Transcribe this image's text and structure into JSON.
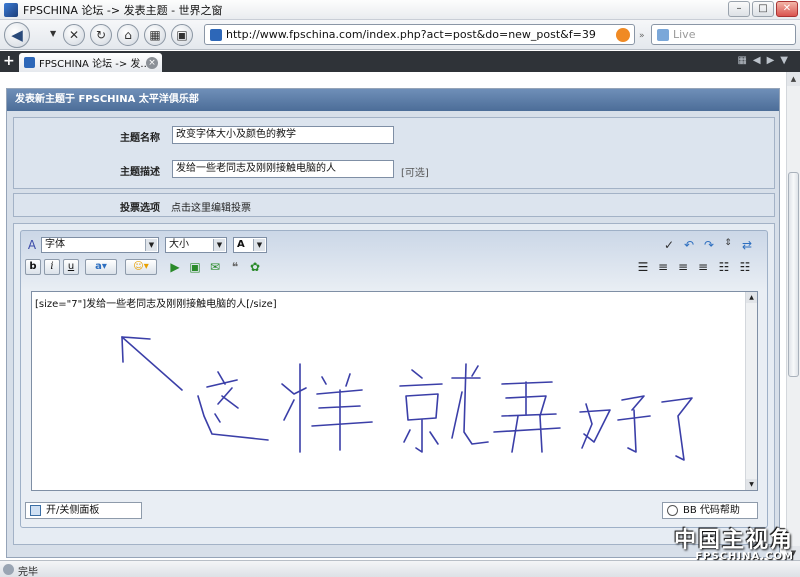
{
  "window": {
    "title": "FPSCHINA 论坛 -> 发表主题 - 世界之窗"
  },
  "nav": {
    "url": "http://www.fpschina.com/index.php?act=post&do=new_post&f=39",
    "search_placeholder": "Live"
  },
  "tabs": [
    {
      "label": "FPSCHINA 论坛 -> 发..."
    }
  ],
  "form": {
    "header": "发表新主题于 FPSCHINA 太平洋俱乐部",
    "subject_label": "主题名称",
    "subject_value": "改变字体大小及颜色的教学",
    "desc_label": "主题描述",
    "desc_value": "发给一些老同志及刚刚接触电脑的人",
    "desc_optional": "[可选]",
    "poll_label": "投票选项",
    "poll_link": "点击这里编辑投票"
  },
  "editor": {
    "font_select": "字体",
    "size_select": "大小",
    "color_select": "A",
    "bold": "b",
    "italic": "i",
    "underline": "u",
    "content": "[size=\"7\"]发给一些老同志及刚刚接触电脑的人[/size]",
    "annotation": "这样就弄好了",
    "panel_toggle": "开/关侧面板",
    "bb_help": "BB 代码帮助"
  },
  "status": {
    "text": "完毕"
  },
  "watermark": {
    "brand": "中国主视角",
    "domain": "FPSCHINA.COM"
  },
  "colors": {
    "header_bg": "#5a7aa5",
    "frame_bg": "#d7dfe9",
    "annotation_ink": "#3b3fa8"
  }
}
